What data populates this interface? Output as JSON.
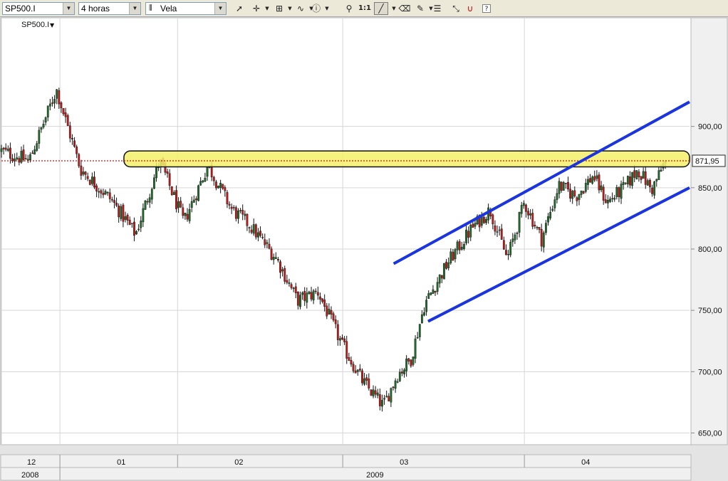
{
  "toolbar": {
    "symbol": "SP500.I",
    "period": "4 horas",
    "chart_style": "Vela",
    "icons": [
      "cursor-icon",
      "crosshair-icon",
      "grid-icon",
      "indicator-icon",
      "info-icon",
      "zoom-icon",
      "zoom-1-1-icon",
      "trendline-icon",
      "eraser-icon",
      "paint-icon",
      "fibonacci-icon",
      "magnet-icon",
      "help-icon"
    ],
    "zoom_label": "1:1",
    "help_label": "?"
  },
  "chart_data": {
    "type": "candlestick",
    "symbol_label": "SP500.I",
    "last_price_label": "871,95",
    "last_price": 871.95,
    "y_range": [
      641,
      988
    ],
    "y_ticks": [
      {
        "value": 650,
        "label": "650,00"
      },
      {
        "value": 700,
        "label": "700,00"
      },
      {
        "value": 750,
        "label": "750,00"
      },
      {
        "value": 800,
        "label": "800,00"
      },
      {
        "value": 850,
        "label": "850,00"
      },
      {
        "value": 900,
        "label": "900,00"
      }
    ],
    "x_month_labels": [
      "12",
      "01",
      "02",
      "03",
      "04"
    ],
    "x_year_labels": [
      "2008",
      "2009"
    ],
    "close_path": [
      [
        0.0,
        880
      ],
      [
        0.04,
        872
      ],
      [
        0.08,
        930
      ],
      [
        0.115,
        865
      ],
      [
        0.16,
        840
      ],
      [
        0.195,
        812
      ],
      [
        0.23,
        872
      ],
      [
        0.265,
        822
      ],
      [
        0.3,
        868
      ],
      [
        0.335,
        832
      ],
      [
        0.36,
        820
      ],
      [
        0.4,
        792
      ],
      [
        0.43,
        758
      ],
      [
        0.46,
        765
      ],
      [
        0.495,
        722
      ],
      [
        0.525,
        692
      ],
      [
        0.555,
        672
      ],
      [
        0.575,
        697
      ],
      [
        0.595,
        710
      ],
      [
        0.615,
        755
      ],
      [
        0.65,
        790
      ],
      [
        0.685,
        818
      ],
      [
        0.71,
        832
      ],
      [
        0.735,
        792
      ],
      [
        0.76,
        838
      ],
      [
        0.785,
        808
      ],
      [
        0.81,
        852
      ],
      [
        0.835,
        843
      ],
      [
        0.86,
        860
      ],
      [
        0.88,
        838
      ],
      [
        0.905,
        850
      ],
      [
        0.925,
        865
      ],
      [
        0.945,
        848
      ],
      [
        0.965,
        872
      ]
    ],
    "annotations": {
      "resistance_zone": {
        "low": 867,
        "high": 880
      },
      "channel_upper": [
        [
          0.57,
          788
        ],
        [
          1.0,
          920
        ]
      ],
      "channel_lower": [
        [
          0.62,
          741
        ],
        [
          1.0,
          850
        ]
      ]
    },
    "grid": true,
    "price_line_dotted": true
  }
}
